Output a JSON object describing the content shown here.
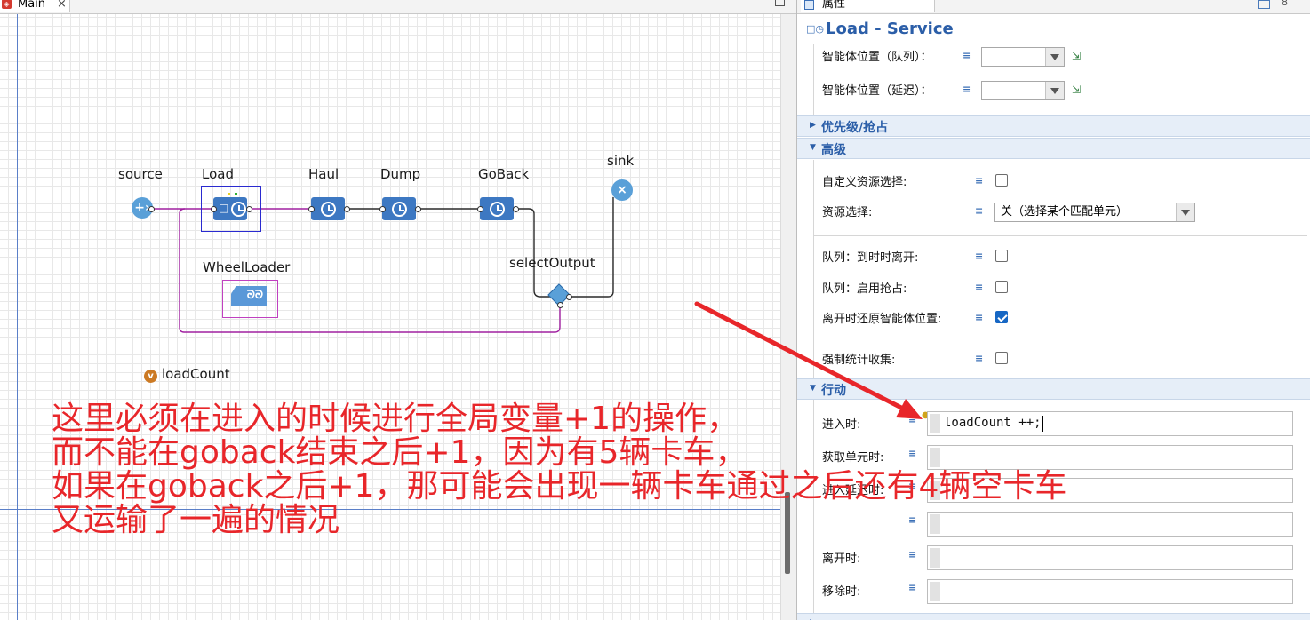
{
  "editor": {
    "tab_title": "Main",
    "tab_close": "×",
    "blocks": {
      "source": {
        "label": "source",
        "icon": "+›"
      },
      "load": {
        "label": "Load"
      },
      "haul": {
        "label": "Haul"
      },
      "dump": {
        "label": "Dump"
      },
      "goback": {
        "label": "GoBack"
      },
      "sink": {
        "label": "sink",
        "icon": "×"
      },
      "select_output": {
        "label": "selectOutput"
      },
      "wheel_loader": {
        "label": "WheelLoader",
        "icon": "ᘒᘒ"
      }
    },
    "variable": {
      "icon": "v",
      "label": "loadCount"
    },
    "colors": {
      "block": "#3d78c2",
      "node": "#5aa0d8",
      "connector": "#a020a0",
      "selection": "#2a2ad0"
    }
  },
  "properties": {
    "tab_title": "属性",
    "tab_close": "8",
    "header_icon": "□◷",
    "title": "Load - Service",
    "agent_location_queue_label": "智能体位置（队列）：",
    "agent_location_queue_value": "",
    "agent_location_delay_label": "智能体位置（延迟）：",
    "agent_location_delay_value": "",
    "section_priority": "优先级/抢占",
    "section_advanced": "高级",
    "custom_resource_selection_label": "自定义资源选择:",
    "custom_resource_selection_checked": false,
    "resource_selection_label": "资源选择:",
    "resource_selection_value": "关（选择某个匹配单元）",
    "queue_exit_on_timeout_label": "队列：到时时离开:",
    "queue_exit_on_timeout_checked": false,
    "queue_enable_preemption_label": "队列：启用抢占:",
    "queue_enable_preemption_checked": false,
    "restore_location_label": "离开时还原智能体位置:",
    "restore_location_checked": true,
    "force_statistics_label": "强制统计收集:",
    "force_statistics_checked": false,
    "section_actions": "行动",
    "on_enter_label": "进入时:",
    "on_enter_code": "loadCount ++;",
    "on_seize_label": "获取单元时:",
    "on_seize_code": "",
    "on_enter_delay_label": "进入延迟时:",
    "on_enter_delay_code": "",
    "on_fourth_label": "",
    "on_fourth_code": "",
    "on_exit_label": "离开时:",
    "on_exit_code": "",
    "on_remove_label": "移除时:",
    "on_remove_code": "",
    "eq_icon": "≡",
    "colors": {
      "accent": "#2b5ea8",
      "section_bg": "#e6eef8",
      "checkbox_on": "#1767c4"
    }
  },
  "annotation": {
    "line1": "这里必须在进入的时候进行全局变量+1的操作，",
    "line2": "而不能在goback结束之后+1，因为有5辆卡车，",
    "line3": "如果在goback之后+1，那可能会出现一辆卡车通过之后还有4辆空卡车",
    "line4": "又运输了一遍的情况",
    "color": "#e8262a"
  }
}
